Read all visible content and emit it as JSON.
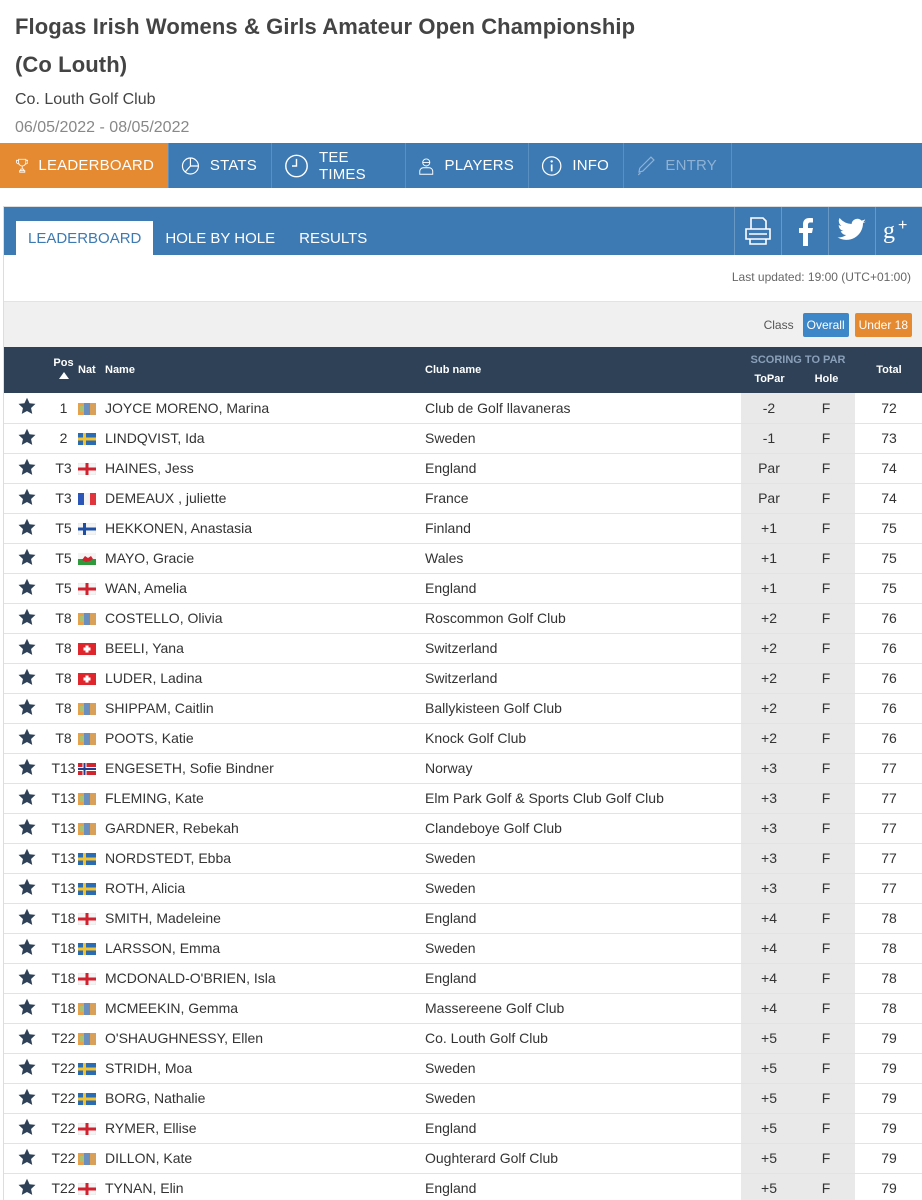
{
  "event": {
    "title_line1": "Flogas Irish Womens & Girls Amateur Open Championship",
    "title_line2": "(Co Louth)",
    "club": "Co. Louth Golf Club",
    "dates": "06/05/2022 - 08/05/2022"
  },
  "main_nav": [
    {
      "label": "LEADERBOARD",
      "icon": "trophy-icon",
      "state": "active"
    },
    {
      "label": "STATS",
      "icon": "pie-chart-icon",
      "state": "normal"
    },
    {
      "label": "TEE TIMES",
      "icon": "clock-icon",
      "state": "normal"
    },
    {
      "label": "PLAYERS",
      "icon": "player-icon",
      "state": "normal"
    },
    {
      "label": "INFO",
      "icon": "info-icon",
      "state": "normal"
    },
    {
      "label": "ENTRY",
      "icon": "pen-icon",
      "state": "disabled"
    }
  ],
  "sub_tabs": [
    "LEADERBOARD",
    "HOLE BY HOLE",
    "RESULTS"
  ],
  "share_icons": [
    "print-icon",
    "facebook-icon",
    "twitter-icon",
    "google-plus-icon"
  ],
  "last_updated": "Last updated: 19:00 (UTC+01:00)",
  "class_filter": {
    "label": "Class",
    "options": [
      "Overall",
      "Under 18"
    ],
    "selected": "Overall"
  },
  "table": {
    "headers": {
      "pos": "Pos",
      "nat": "Nat",
      "name": "Name",
      "club": "Club name",
      "group": "SCORING TO PAR",
      "topar": "ToPar",
      "hole": "Hole",
      "total": "Total"
    },
    "rows": [
      {
        "pos": "1",
        "flag": "ireland",
        "name": "JOYCE MORENO, Marina",
        "club": "Club de Golf llavaneras",
        "topar": "-2",
        "hole": "F",
        "total": "72"
      },
      {
        "pos": "2",
        "flag": "sweden",
        "name": "LINDQVIST, Ida",
        "club": "Sweden",
        "topar": "-1",
        "hole": "F",
        "total": "73"
      },
      {
        "pos": "T3",
        "flag": "england",
        "name": "HAINES, Jess",
        "club": "England",
        "topar": "Par",
        "hole": "F",
        "total": "74"
      },
      {
        "pos": "T3",
        "flag": "france",
        "name": "DEMEAUX , juliette",
        "club": "France",
        "topar": "Par",
        "hole": "F",
        "total": "74"
      },
      {
        "pos": "T5",
        "flag": "finland",
        "name": "HEKKONEN, Anastasia",
        "club": "Finland",
        "topar": "+1",
        "hole": "F",
        "total": "75"
      },
      {
        "pos": "T5",
        "flag": "wales",
        "name": "MAYO, Gracie",
        "club": "Wales",
        "topar": "+1",
        "hole": "F",
        "total": "75"
      },
      {
        "pos": "T5",
        "flag": "england",
        "name": "WAN, Amelia",
        "club": "England",
        "topar": "+1",
        "hole": "F",
        "total": "75"
      },
      {
        "pos": "T8",
        "flag": "ireland",
        "name": "COSTELLO, Olivia",
        "club": "Roscommon Golf Club",
        "topar": "+2",
        "hole": "F",
        "total": "76"
      },
      {
        "pos": "T8",
        "flag": "switzerland",
        "name": "BEELI, Yana",
        "club": "Switzerland",
        "topar": "+2",
        "hole": "F",
        "total": "76"
      },
      {
        "pos": "T8",
        "flag": "switzerland",
        "name": "LUDER, Ladina",
        "club": "Switzerland",
        "topar": "+2",
        "hole": "F",
        "total": "76"
      },
      {
        "pos": "T8",
        "flag": "ireland",
        "name": "SHIPPAM, Caitlin",
        "club": "Ballykisteen Golf Club",
        "topar": "+2",
        "hole": "F",
        "total": "76"
      },
      {
        "pos": "T8",
        "flag": "ireland",
        "name": "POOTS, Katie",
        "club": "Knock Golf Club",
        "topar": "+2",
        "hole": "F",
        "total": "76"
      },
      {
        "pos": "T13",
        "flag": "norway",
        "name": "ENGESETH, Sofie Bindner",
        "club": "Norway",
        "topar": "+3",
        "hole": "F",
        "total": "77"
      },
      {
        "pos": "T13",
        "flag": "ireland",
        "name": "FLEMING, Kate",
        "club": "Elm Park Golf & Sports Club Golf Club",
        "topar": "+3",
        "hole": "F",
        "total": "77"
      },
      {
        "pos": "T13",
        "flag": "ireland",
        "name": "GARDNER, Rebekah",
        "club": "Clandeboye Golf Club",
        "topar": "+3",
        "hole": "F",
        "total": "77"
      },
      {
        "pos": "T13",
        "flag": "sweden",
        "name": "NORDSTEDT, Ebba",
        "club": "Sweden",
        "topar": "+3",
        "hole": "F",
        "total": "77"
      },
      {
        "pos": "T13",
        "flag": "sweden",
        "name": "ROTH, Alicia",
        "club": "Sweden",
        "topar": "+3",
        "hole": "F",
        "total": "77"
      },
      {
        "pos": "T18",
        "flag": "england",
        "name": "SMITH, Madeleine",
        "club": "England",
        "topar": "+4",
        "hole": "F",
        "total": "78"
      },
      {
        "pos": "T18",
        "flag": "sweden",
        "name": "LARSSON, Emma",
        "club": "Sweden",
        "topar": "+4",
        "hole": "F",
        "total": "78"
      },
      {
        "pos": "T18",
        "flag": "england",
        "name": "MCDONALD-O'BRIEN, Isla",
        "club": "England",
        "topar": "+4",
        "hole": "F",
        "total": "78"
      },
      {
        "pos": "T18",
        "flag": "ireland",
        "name": "MCMEEKIN, Gemma",
        "club": "Massereene Golf Club",
        "topar": "+4",
        "hole": "F",
        "total": "78"
      },
      {
        "pos": "T22",
        "flag": "ireland",
        "name": "O'SHAUGHNESSY, Ellen",
        "club": "Co. Louth Golf Club",
        "topar": "+5",
        "hole": "F",
        "total": "79"
      },
      {
        "pos": "T22",
        "flag": "sweden",
        "name": "STRIDH, Moa",
        "club": "Sweden",
        "topar": "+5",
        "hole": "F",
        "total": "79"
      },
      {
        "pos": "T22",
        "flag": "sweden",
        "name": "BORG, Nathalie",
        "club": "Sweden",
        "topar": "+5",
        "hole": "F",
        "total": "79"
      },
      {
        "pos": "T22",
        "flag": "england",
        "name": "RYMER, Ellise",
        "club": "England",
        "topar": "+5",
        "hole": "F",
        "total": "79"
      },
      {
        "pos": "T22",
        "flag": "ireland",
        "name": "DILLON, Kate",
        "club": "Oughterard Golf Club",
        "topar": "+5",
        "hole": "F",
        "total": "79"
      },
      {
        "pos": "T22",
        "flag": "england",
        "name": "TYNAN, Elin",
        "club": "England",
        "topar": "+5",
        "hole": "F",
        "total": "79"
      }
    ]
  },
  "colors": {
    "nav_blue": "#3d7ab3",
    "accent_orange": "#e58a30",
    "header_dark": "#2e4157"
  }
}
